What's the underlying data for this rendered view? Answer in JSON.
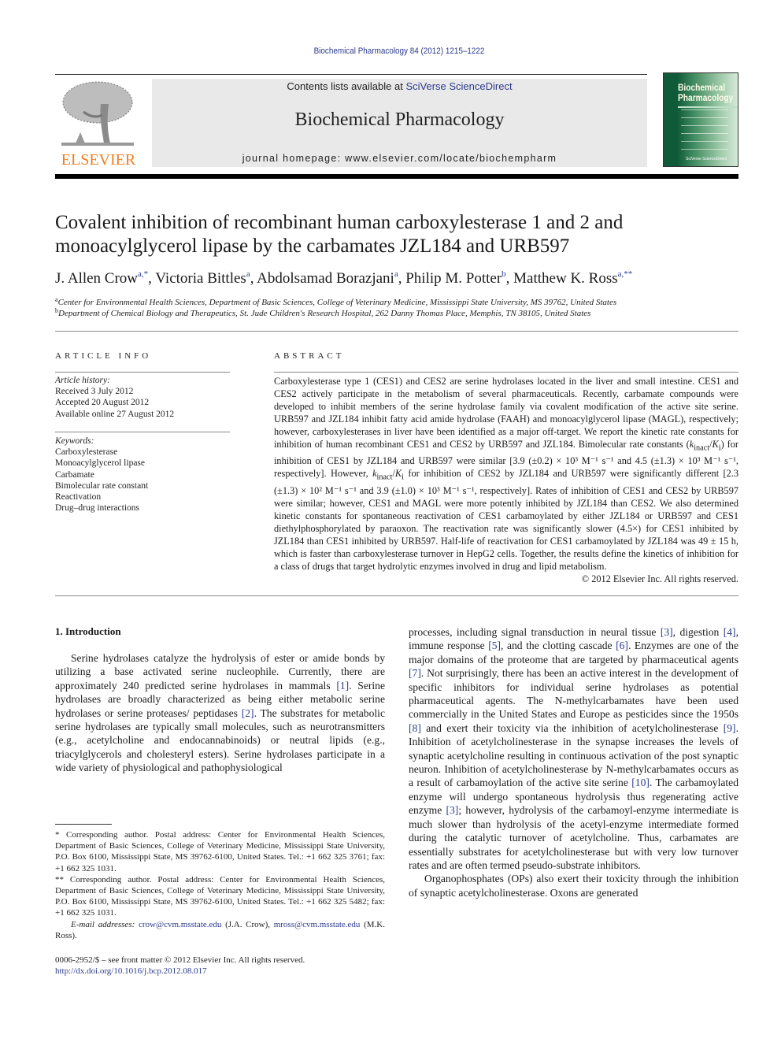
{
  "running_head": "Biochemical Pharmacology 84 (2012) 1215–1222",
  "header": {
    "publisher_logo_text": "ELSEVIER",
    "contents_prefix": "Contents lists available at ",
    "contents_link": "SciVerse ScienceDirect",
    "journal_title": "Biochemical Pharmacology",
    "homepage_prefix": "journal homepage: ",
    "homepage_url": "www.elsevier.com/locate/biochempharm",
    "cover": {
      "title_line1": "Biochemical",
      "title_line2": "Pharmacology",
      "footer": "SciVerse ScienceDirect"
    },
    "colors": {
      "publisher_orange": "#f07e1d",
      "link_blue": "#2c3a8c",
      "cover_green": "#0f5a38"
    }
  },
  "article": {
    "title": "Covalent inhibition of recombinant human carboxylesterase 1 and 2 and monoacylglycerol lipase by the carbamates JZL184 and URB597",
    "authors": [
      {
        "name": "J. Allen Crow",
        "marks": "a,*"
      },
      {
        "name": "Victoria Bittles",
        "marks": "a"
      },
      {
        "name": "Abdolsamad Borazjani",
        "marks": "a"
      },
      {
        "name": "Philip M. Potter",
        "marks": "b"
      },
      {
        "name": "Matthew K. Ross",
        "marks": "a,**"
      }
    ],
    "affiliations": [
      {
        "mark": "a",
        "text": "Center for Environmental Health Sciences, Department of Basic Sciences, College of Veterinary Medicine, Mississippi State University, MS 39762, United States"
      },
      {
        "mark": "b",
        "text": "Department of Chemical Biology and Therapeutics, St. Jude Children's Research Hospital, 262 Danny Thomas Place, Memphis, TN 38105, United States"
      }
    ]
  },
  "article_info": {
    "heading": "ARTICLE INFO",
    "history_label": "Article history:",
    "history": [
      "Received 3 July 2012",
      "Accepted 20 August 2012",
      "Available online 27 August 2012"
    ],
    "keywords_label": "Keywords:",
    "keywords": [
      "Carboxylesterase",
      "Monoacylglycerol lipase",
      "Carbamate",
      "Bimolecular rate constant",
      "Reactivation",
      "Drug–drug interactions"
    ]
  },
  "abstract": {
    "heading": "ABSTRACT",
    "p1": "Carboxylesterase type 1 (CES1) and CES2 are serine hydrolases located in the liver and small intestine. CES1 and CES2 actively participate in the metabolism of several pharmaceuticals. Recently, carbamate compounds were developed to inhibit members of the serine hydrolase family via covalent modification of the active site serine. URB597 and JZL184 inhibit fatty acid amide hydrolase (FAAH) and monoacylglycerol lipase (MAGL), respectively; however, carboxylesterases in liver have been identified as a major off-target. We report the kinetic rate constants for inhibition of human recombinant CES1 and CES2 by URB597 and JZL184. Bimolecular rate constants (",
    "k_sym": "k",
    "k_sub": "inact",
    "slash": "/",
    "K_sym": "K",
    "K_sub": "i",
    "p2": ") for inhibition of CES1 by JZL184 and URB597 were similar [3.9 (±0.2) × 10³ M⁻¹ s⁻¹ and 4.5 (±1.3) × 10³ M⁻¹ s⁻¹, respectively]. However, ",
    "p3": " for inhibition of CES2 by JZL184 and URB597 were significantly different [2.3 (±1.3) × 10² M⁻¹ s⁻¹ and 3.9 (±1.0) × 10³ M⁻¹ s⁻¹, respectively]. Rates of inhibition of CES1 and CES2 by URB597 were similar; however, CES1 and MAGL were more potently inhibited by JZL184 than CES2. We also determined kinetic constants for spontaneous reactivation of CES1 carbamoylated by either JZL184 or URB597 and CES1 diethylphosphorylated by paraoxon. The reactivation rate was significantly slower (4.5×) for CES1 inhibited by JZL184 than CES1 inhibited by URB597. Half-life of reactivation for CES1 carbamoylated by JZL184 was 49 ± 15 h, which is faster than carboxylesterase turnover in HepG2 cells. Together, the results define the kinetics of inhibition for a class of drugs that target hydrolytic enzymes involved in drug and lipid metabolism.",
    "copyright": "© 2012 Elsevier Inc. All rights reserved."
  },
  "introduction": {
    "heading": "1. Introduction",
    "left_p1": [
      {
        "t": "Serine hydrolases catalyze the hydrolysis of ester or amide bonds by utilizing a base activated serine nucleophile. Currently, there are approximately 240 predicted serine hydrolases in mammals "
      },
      {
        "ref": "[1]"
      },
      {
        "t": ". Serine hydrolases are broadly characterized as being either metabolic serine hydrolases or serine proteases/ peptidases "
      },
      {
        "ref": "[2]"
      },
      {
        "t": ". The substrates for metabolic serine hydrolases are typically small molecules, such as neurotransmitters (e.g., acetylcholine and endocannabinoids) or neutral lipids (e.g., triacylglycerols and cholesteryl esters). Serine hydrolases participate in a wide variety of physiological and pathophysiological"
      }
    ],
    "right_p1": [
      {
        "t": "processes, including signal transduction in neural tissue "
      },
      {
        "ref": "[3]"
      },
      {
        "t": ", digestion "
      },
      {
        "ref": "[4]"
      },
      {
        "t": ", immune response "
      },
      {
        "ref": "[5]"
      },
      {
        "t": ", and the clotting cascade "
      },
      {
        "ref": "[6]"
      },
      {
        "t": ". Enzymes are one of the major domains of the proteome that are targeted by pharmaceutical agents "
      },
      {
        "ref": "[7]"
      },
      {
        "t": ". Not surprisingly, there has been an active interest in the development of specific inhibitors for individual serine hydrolases as potential pharmaceutical agents. The N-methylcarbamates have been used commercially in the United States and Europe as pesticides since the 1950s "
      },
      {
        "ref": "[8]"
      },
      {
        "t": " and exert their toxicity via the inhibition of acetylcholinesterase "
      },
      {
        "ref": "[9]"
      },
      {
        "t": ". Inhibition of acetylcholinesterase in the synapse increases the levels of synaptic acetylcholine resulting in continuous activation of the post synaptic neuron. Inhibition of acetylcholinesterase by N-methylcarbamates occurs as a result of carbamoylation of the active site serine "
      },
      {
        "ref": "[10]"
      },
      {
        "t": ". The carbamoylated enzyme will undergo spontaneous hydrolysis thus regenerating active enzyme "
      },
      {
        "ref": "[3]"
      },
      {
        "t": "; however, hydrolysis of the carbamoyl-enzyme intermediate is much slower than hydrolysis of the acetyl-enzyme intermediate formed during the catalytic turnover of acetylcholine. Thus, carbamates are essentially substrates for acetylcholinesterase but with very low turnover rates and are often termed pseudo-substrate inhibitors."
      }
    ],
    "right_p2": "Organophosphates (OPs) also exert their toxicity through the inhibition of synaptic acetylcholinesterase. Oxons are generated"
  },
  "footnotes": {
    "fn1": "* Corresponding author. Postal address: Center for Environmental Health Sciences, Department of Basic Sciences, College of Veterinary Medicine, Mississippi State University, P.O. Box 6100, Mississippi State, MS 39762-6100, United States. Tel.: +1 662 325 3761; fax: +1 662 325 1031.",
    "fn2": "** Corresponding author. Postal address: Center for Environmental Health Sciences, Department of Basic Sciences, College of Veterinary Medicine, Mississippi State University, P.O. Box 6100, Mississippi State, MS 39762-6100, United States. Tel.: +1 662 325 5482; fax: +1 662 325 1031.",
    "email_label": "E-mail addresses: ",
    "email1": "crow@cvm.msstate.edu",
    "email1_owner": " (J.A. Crow), ",
    "email2": "mross@cvm.msstate.edu",
    "email2_owner": " (M.K. Ross).",
    "front_matter": "0006-2952/$ – see front matter © 2012 Elsevier Inc. All rights reserved.",
    "doi": "http://dx.doi.org/10.1016/j.bcp.2012.08.017"
  }
}
